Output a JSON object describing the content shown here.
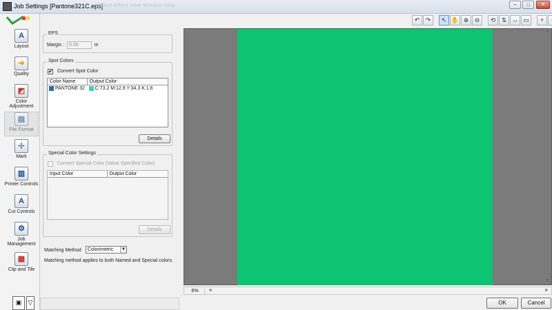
{
  "window": {
    "title": "Job Settings [Pantone321C.eps]",
    "ghost_menu": "Select  Effect  View  Window  Help"
  },
  "nav": {
    "items": [
      {
        "label": "Layout",
        "icon": "layout-icon",
        "glyph": "A"
      },
      {
        "label": "Quality",
        "icon": "quality-icon",
        "glyph": "➜"
      },
      {
        "label": "Color Adjustment",
        "icon": "color-adjustment-icon",
        "glyph": "◩"
      },
      {
        "label": "File Format",
        "icon": "file-format-icon",
        "glyph": "▤"
      },
      {
        "label": "Mark",
        "icon": "mark-icon",
        "glyph": "⊹"
      },
      {
        "label": "Printer Controls",
        "icon": "printer-controls-icon",
        "glyph": "▥"
      },
      {
        "label": "Cut Controls",
        "icon": "cut-controls-icon",
        "glyph": "A"
      },
      {
        "label": "Job Management",
        "icon": "job-management-icon",
        "glyph": "⚙"
      },
      {
        "label": "Clip and Tile",
        "icon": "clip-and-tile-icon",
        "glyph": "▦"
      }
    ]
  },
  "eps": {
    "title": "EPS",
    "margin_label": "Margin :",
    "margin_value": "0.00",
    "margin_unit": "in"
  },
  "spot_colors": {
    "title": "Spot Colors",
    "convert_label": "Convert Spot Color",
    "convert_checked": "✔",
    "columns": [
      "Color Name",
      "Output Color"
    ],
    "rows": [
      {
        "name": "PANTONE 32",
        "output": "C:73.2    M:12.9   Y:34.3    K:1.6",
        "swatch": "#3fd3a8"
      }
    ],
    "details_label": "Details"
  },
  "special_colors": {
    "title": "Special Color Settings",
    "convert_label": "Convert Special Color (Value Specified Color)",
    "columns": [
      "Input Color",
      "Output Color"
    ],
    "details_label": "Details"
  },
  "matching": {
    "label": "Matching Method",
    "value": "Colorimetric",
    "note": "Matching method applies to both Named and Special colors."
  },
  "preview": {
    "zoom": "6%",
    "page_color": "#0cc471"
  },
  "footer": {
    "ok_label": "OK",
    "cancel_label": "Cancel"
  }
}
